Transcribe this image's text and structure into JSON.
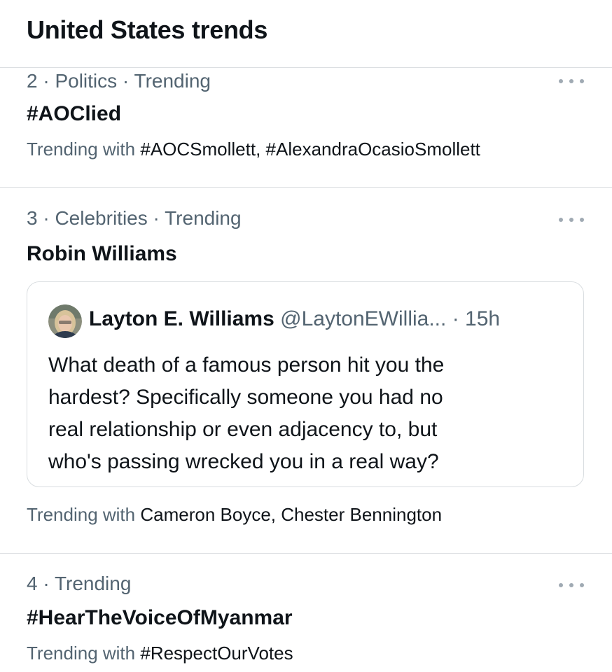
{
  "page": {
    "title": "United States trends"
  },
  "trends": [
    {
      "meta": "2 · Politics · Trending",
      "name": "#AOClied",
      "with_prefix": "Trending with",
      "with_items": "#AOCSmollett, #AlexandraOcasioSmollett"
    },
    {
      "meta": "3 · Celebrities · Trending",
      "name": "Robin Williams",
      "with_prefix": "Trending with",
      "with_items": "Cameron Boyce, Chester Bennington",
      "tweet": {
        "author_name": "Layton E. Williams",
        "author_handle": "@LaytonEWillia...",
        "time": "· 15h",
        "text": "What death of a famous person hit you the\nhardest? Specifically someone you had no\nreal relationship or even adjacency to, but\nwho's passing wrecked you in a real way?"
      }
    },
    {
      "meta": "4 · Trending",
      "name": "#HearTheVoiceOfMyanmar",
      "with_prefix": "Trending with",
      "with_items": "#RespectOurVotes"
    }
  ],
  "icons": {
    "more": "more-horizontal-icon"
  },
  "colors": {
    "primary_text": "#0f1419",
    "secondary_text": "#536471",
    "divider": "#dcdfe2"
  }
}
